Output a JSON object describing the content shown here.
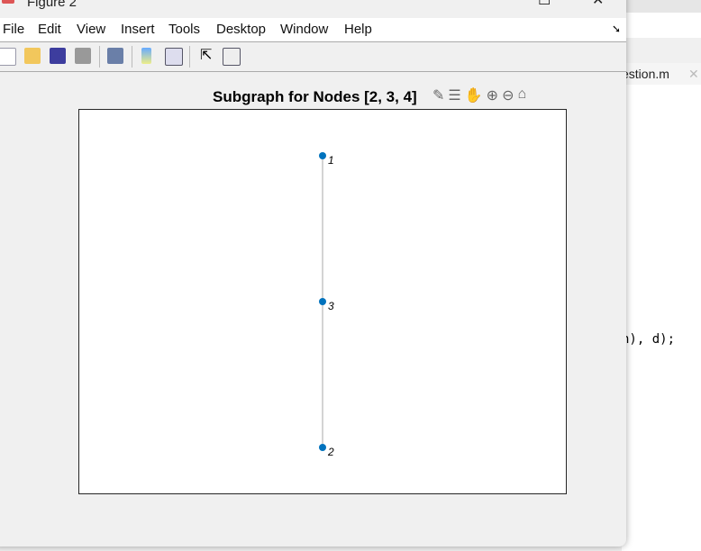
{
  "window": {
    "title": "Figure 2"
  },
  "menu": [
    "File",
    "Edit",
    "View",
    "Insert",
    "Tools",
    "Desktop",
    "Window",
    "Help"
  ],
  "toolbar": [
    "new-figure",
    "open-file",
    "save",
    "print",
    "link-plot",
    "insert-colorbar",
    "insert-legend",
    "edit-plot",
    "property-inspector"
  ],
  "axes_toolbar": [
    "brush",
    "data-tips",
    "pan",
    "zoom-in",
    "zoom-out",
    "restore-view"
  ],
  "plot": {
    "title": "Subgraph for Nodes [2, 3, 4]",
    "nodes": [
      {
        "label": "1",
        "y": 3
      },
      {
        "label": "3",
        "y": 2
      },
      {
        "label": "2",
        "y": 1
      }
    ],
    "edges": [
      [
        "1",
        "3"
      ],
      [
        "3",
        "2"
      ]
    ],
    "node_color": "#0072BD",
    "edge_color": "#AAAAAA"
  },
  "editor": {
    "tab_label": "estion.m",
    "code_line": "h), d);"
  }
}
